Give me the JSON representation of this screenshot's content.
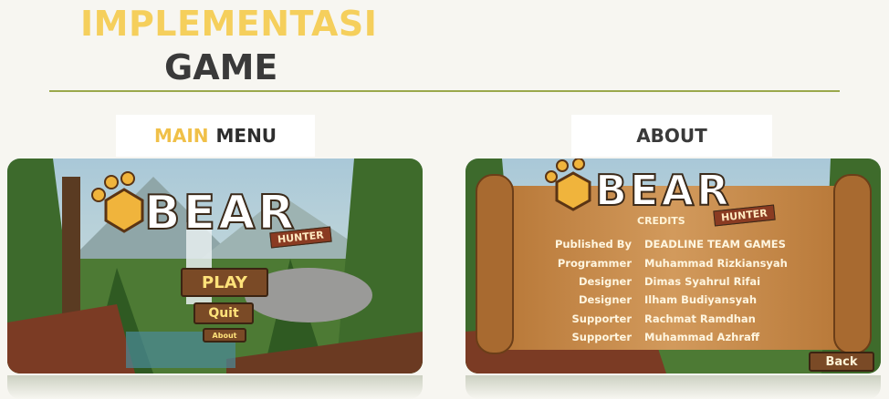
{
  "header": {
    "title_line1": "IMPLEMENTASI",
    "title_line2": "GAME"
  },
  "panels": {
    "main_menu": {
      "label_word1": "MAIN",
      "label_word2": "MENU"
    },
    "about": {
      "label": "ABOUT"
    }
  },
  "game": {
    "logo_text": "BEAR",
    "logo_subtitle": "HUNTER",
    "menu": {
      "play": "PLAY",
      "quit": "Quit",
      "about": "About"
    },
    "about_screen": {
      "credits_title": "CREDITS",
      "credits": [
        {
          "role": "Published By",
          "name": "DEADLINE TEAM GAMES"
        },
        {
          "role": "Programmer",
          "name": "Muhammad Rizkiansyah"
        },
        {
          "role": "Designer",
          "name": "Dimas Syahrul Rifai"
        },
        {
          "role": "Designer",
          "name": "Ilham Budiyansyah"
        },
        {
          "role": "Supporter",
          "name": "Rachmat Ramdhan"
        },
        {
          "role": "Supporter",
          "name": "Muhammad Azhraff"
        }
      ],
      "back": "Back"
    }
  },
  "colors": {
    "title_accent": "#f5cf5c",
    "title_dark": "#3a3a3a",
    "divider": "#9aa84c",
    "button_wood": "#7a4a26",
    "button_text": "#ffe27a",
    "parchment": "#c98a4c"
  }
}
